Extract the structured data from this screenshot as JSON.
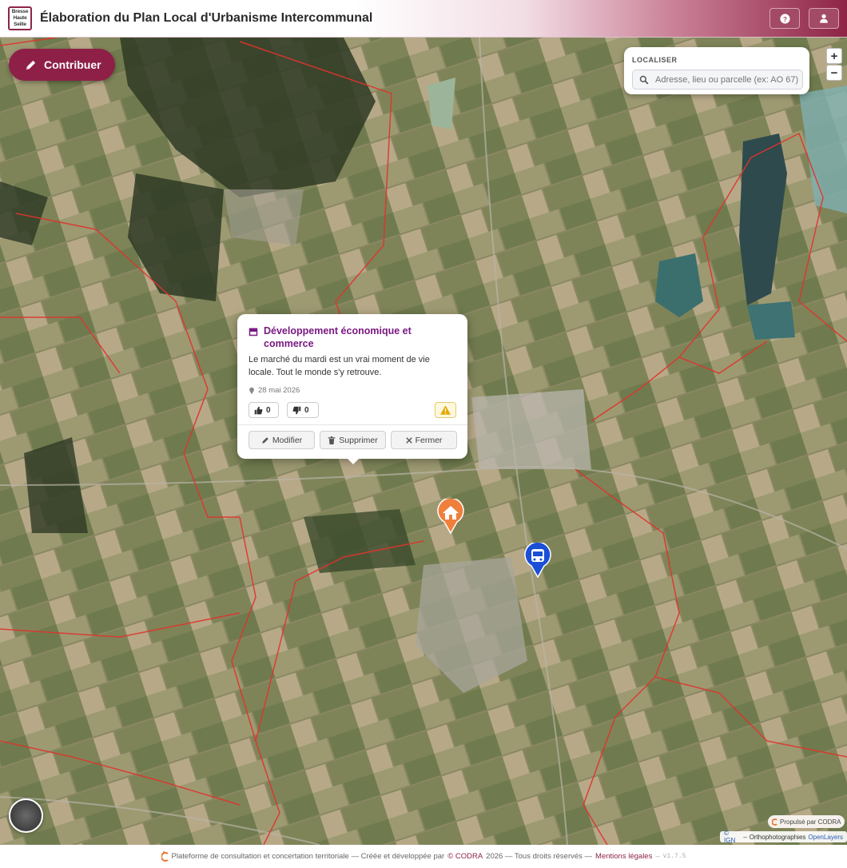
{
  "header": {
    "logo_lines": [
      "Bresse",
      "Haute",
      "Seille"
    ],
    "title": "Élaboration du Plan Local d'Urbanisme Intercommunal",
    "help_icon": "question-circle-icon",
    "user_icon": "user-icon"
  },
  "toolbar": {
    "contribute_label": "Contribuer"
  },
  "locate": {
    "label": "LOCALISER",
    "placeholder": "Adresse, lieu ou parcelle (ex: AO 67)"
  },
  "zoom": {
    "in_label": "+",
    "out_label": "−"
  },
  "popup": {
    "category": "Développement économique et commerce",
    "text": "Le marché du mardi est un vrai moment de vie locale. Tout le monde s'y retrouve.",
    "date": "28 mai 2026",
    "likes": "0",
    "dislikes": "0",
    "edit_label": "Modifier",
    "delete_label": "Supprimer",
    "close_label": "Fermer"
  },
  "markers": {
    "home_color": "#f07f3c",
    "transport_color": "#1a4fd6"
  },
  "attribution": {
    "powered": "Propulsé par CODRA",
    "ign": "© IGN",
    "sep": "–",
    "ortho": "Orthophotographies",
    "ol": "OpenLayers"
  },
  "footer": {
    "text1": "Plateforme de consultation et concertation territoriale — Créée et développée par",
    "brand": "© CODRA",
    "text2": "2026 — Tous droits réservés —",
    "legal": "Mentions légales",
    "dash": "–",
    "version": "v1.7.5"
  },
  "colors": {
    "brand": "#8e1f47",
    "popup_title": "#7a1a82",
    "boundary": "#e0332e"
  }
}
